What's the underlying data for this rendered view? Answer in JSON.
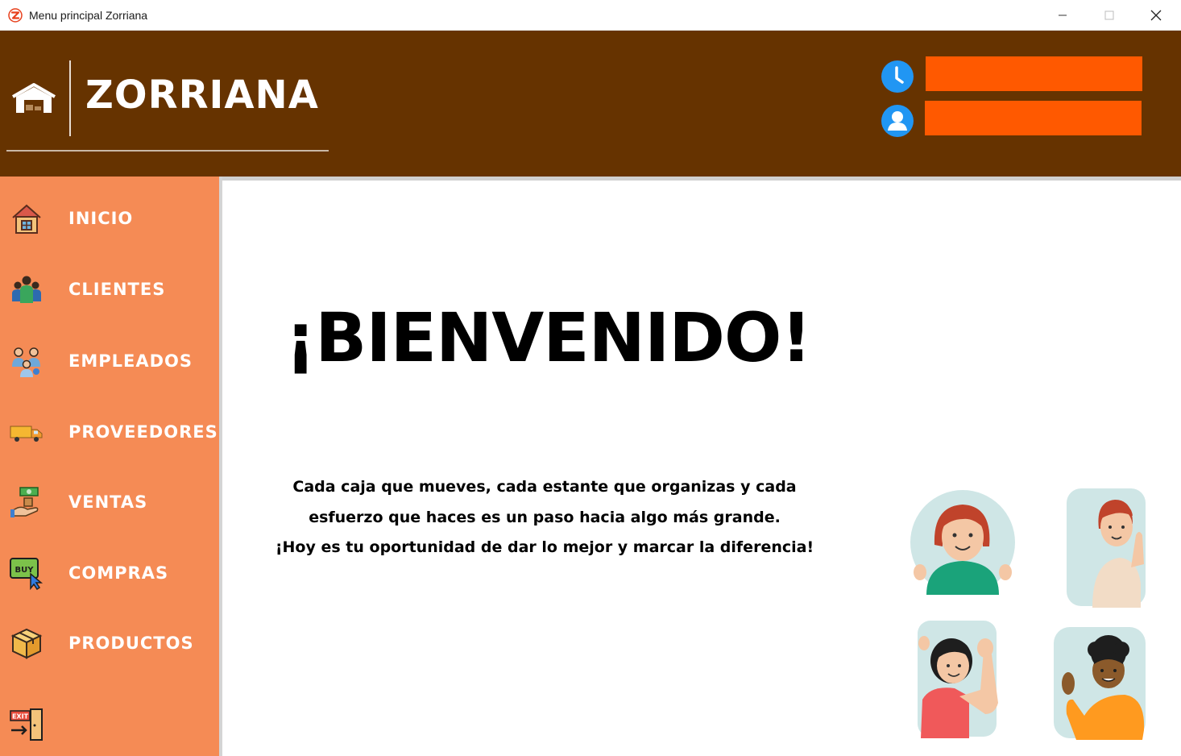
{
  "window": {
    "title": "Menu principal Zorriana",
    "icon": "zorriana-z-logo-icon",
    "controls": [
      "minimize-icon",
      "maximize-icon",
      "close-icon"
    ]
  },
  "header": {
    "brand": "ZORRIANA",
    "logo_icon": "warehouse-icon",
    "time_icon": "clock-icon",
    "user_icon": "user-icon",
    "time_value": "",
    "user_value": ""
  },
  "sidebar": {
    "items": [
      {
        "label": "INICIO",
        "icon": "house-icon"
      },
      {
        "label": "CLIENTES",
        "icon": "group-icon"
      },
      {
        "label": "EMPLEADOS",
        "icon": "employees-icon"
      },
      {
        "label": "PROVEEDORES",
        "icon": "truck-icon"
      },
      {
        "label": "VENTAS",
        "icon": "money-hand-icon"
      },
      {
        "label": "COMPRAS",
        "icon": "buy-cursor-icon"
      },
      {
        "label": "PRODUCTOS",
        "icon": "box-icon"
      }
    ],
    "exit": {
      "label": "EXIT",
      "icon": "exit-door-icon"
    }
  },
  "main": {
    "welcome": "¡BIENVENIDO!",
    "message": [
      "Cada caja que mueves, cada estante que organizas y cada",
      "esfuerzo que haces es un paso hacia algo más grande.",
      "¡Hoy es tu oportunidad de dar lo mejor y marcar la diferencia!"
    ]
  },
  "colors": {
    "header": "#663300",
    "sidebar": "#f58b55",
    "fields": "#ff5900",
    "info_icons": "#2196f3"
  }
}
